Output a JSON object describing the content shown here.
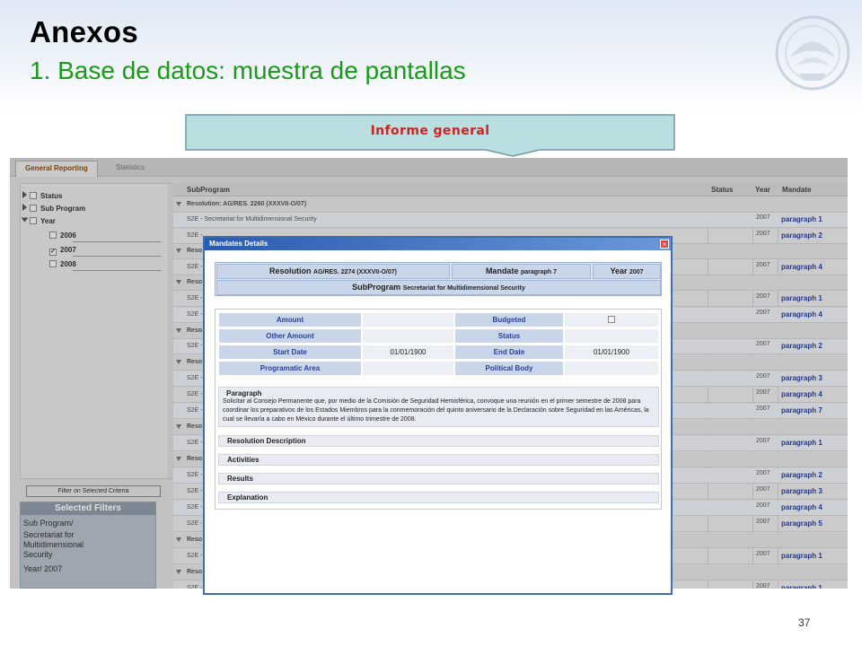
{
  "slide": {
    "title": "Anexos",
    "subtitle": "1. Base de datos: muestra de pantallas",
    "callout": "Informe general",
    "page_number": "37",
    "colors": {
      "title": "#000000",
      "subtitle": "#1a9a1a",
      "callout_text": "#d42020",
      "callout_fill": "#b9dfe0",
      "link": "#2b3f9a"
    }
  },
  "app": {
    "tabs": [
      "General Reporting",
      "Statistics"
    ],
    "filters": {
      "tree": [
        "Status",
        "Sub Program",
        "Year"
      ],
      "years": [
        {
          "label": "2006",
          "checked": false
        },
        {
          "label": "2007",
          "checked": true
        },
        {
          "label": "2008",
          "checked": false
        }
      ],
      "filter_button": "Filter on Selected Criteria"
    },
    "selected_filters": {
      "heading": "Selected Filters",
      "lines": [
        "Sub Program/",
        "Secretariat for",
        "Multidimensional",
        "Security",
        "Year/ 2007"
      ]
    },
    "table": {
      "headers": {
        "subprogram": "SubProgram",
        "status": "Status",
        "year": "Year",
        "mandate": "Mandate"
      },
      "rows": [
        {
          "kind": "res",
          "sub": "Resolution: AG/RES. 2260 (XXXVII-O/07)"
        },
        {
          "kind": "item",
          "sub": "S2E - Secretariat for Multidimensional Security",
          "year": "2007",
          "mandate": "paragraph 1"
        },
        {
          "kind": "item",
          "sub": "S2E -",
          "year": "2007",
          "mandate": "paragraph 2"
        },
        {
          "kind": "res",
          "sub": "Reso"
        },
        {
          "kind": "item",
          "sub": "S2E -",
          "year": "2007",
          "mandate": "paragraph 4"
        },
        {
          "kind": "res",
          "sub": "Reso"
        },
        {
          "kind": "item",
          "sub": "S2E -",
          "year": "2007",
          "mandate": "paragraph 1"
        },
        {
          "kind": "item",
          "sub": "S2E -",
          "year": "2007",
          "mandate": "paragraph 4"
        },
        {
          "kind": "res",
          "sub": "Reso"
        },
        {
          "kind": "item",
          "sub": "S2E -",
          "year": "2007",
          "mandate": "paragraph 2"
        },
        {
          "kind": "res",
          "sub": "Reso"
        },
        {
          "kind": "item",
          "sub": "S2E -",
          "year": "2007",
          "mandate": "paragraph 3"
        },
        {
          "kind": "item",
          "sub": "S2E -",
          "year": "2007",
          "mandate": "paragraph 4"
        },
        {
          "kind": "item",
          "sub": "S2E -",
          "year": "2007",
          "mandate": "paragraph 7"
        },
        {
          "kind": "res",
          "sub": "Reso"
        },
        {
          "kind": "item",
          "sub": "S2E -",
          "year": "2007",
          "mandate": "paragraph 1"
        },
        {
          "kind": "res",
          "sub": "Reso"
        },
        {
          "kind": "item",
          "sub": "S2E -",
          "year": "2007",
          "mandate": "paragraph 2"
        },
        {
          "kind": "item",
          "sub": "S2E -",
          "year": "2007",
          "mandate": "paragraph 3"
        },
        {
          "kind": "item",
          "sub": "S2E -",
          "year": "2007",
          "mandate": "paragraph 4"
        },
        {
          "kind": "item",
          "sub": "S2E -",
          "year": "2007",
          "mandate": "paragraph 5"
        },
        {
          "kind": "res",
          "sub": "Reso"
        },
        {
          "kind": "item",
          "sub": "S2E -",
          "year": "2007",
          "mandate": "paragraph 1"
        },
        {
          "kind": "res",
          "sub": "Reso"
        },
        {
          "kind": "item",
          "sub": "S2E -",
          "year": "2007",
          "mandate": "paragraph 1"
        }
      ]
    }
  },
  "modal": {
    "title": "Mandates Details",
    "close": "×",
    "resolution_label": "Resolution",
    "resolution_value": "AG/RES. 2274 (XXXVII-O/07)",
    "mandate_label": "Mandate",
    "mandate_value": "paragraph 7",
    "year_label": "Year",
    "year_value": "2007",
    "subprogram_label": "SubProgram",
    "subprogram_value": "Secretariat for Multidimensional Security",
    "fields": {
      "amount": "Amount",
      "budgeted": "Budgeted",
      "other_amount": "Other Amount",
      "status": "Status",
      "start_date": "Start Date",
      "start_date_value": "01/01/1900",
      "end_date": "End Date",
      "end_date_value": "01/01/1900",
      "programatic_area": "Programatic Area",
      "political_body": "Political Body"
    },
    "paragraph_heading": "Paragraph",
    "paragraph_text": "Solicitar al Consejo Permanente que, por medio de la Comisión de Seguridad Hemisférica, convoque una reunión en el primer semestre de 2008 para coordinar los preparativos de los Estados Miembros para la conmemoración del quinto aniversario de la Declaración sobre Seguridad en las Américas, la cual se llevaría a cabo en México durante el último trimestre de 2008.",
    "sections": [
      "Resolution Description",
      "Activities",
      "Results",
      "Explanation"
    ]
  }
}
